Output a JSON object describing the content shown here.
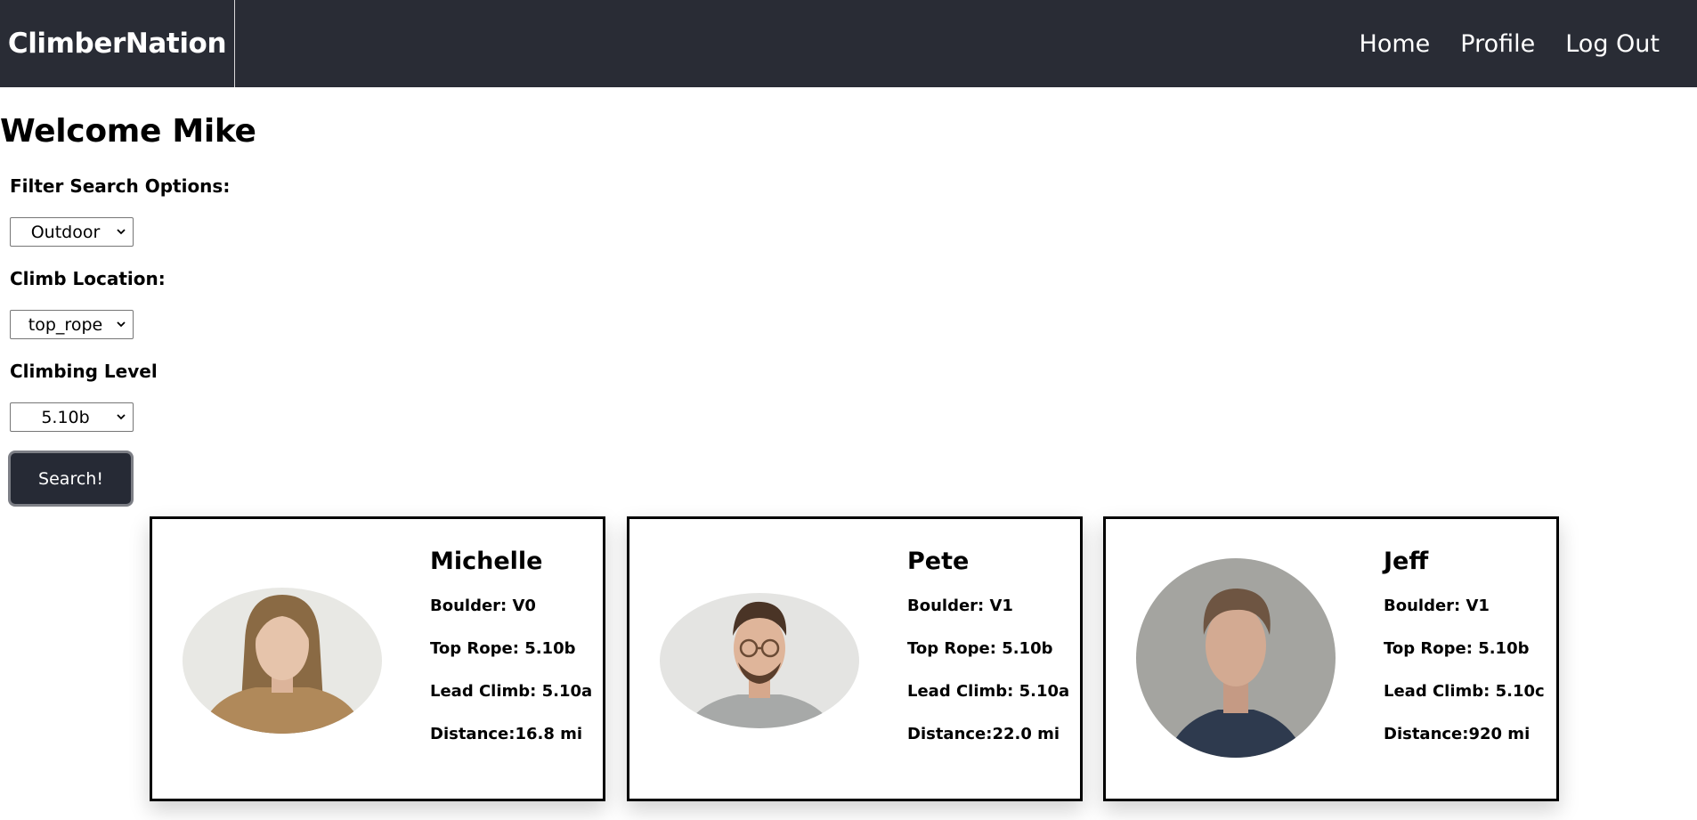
{
  "app": {
    "brand": "ClimberNation"
  },
  "nav": {
    "items": [
      "Home",
      "Profile",
      "Log Out"
    ]
  },
  "welcome": "Welcome Mike",
  "filters": {
    "filter_label": "Filter Search Options:",
    "filter_value": "Outdoor",
    "location_label": "Climb Location:",
    "location_value": "top_rope",
    "level_label": "Climbing Level",
    "level_value": "5.10b"
  },
  "search_button": "Search!",
  "colors": {
    "navbar": "#292c35",
    "button": "#262a35"
  },
  "climbers": [
    {
      "name": "Michelle",
      "boulder": "Boulder: V0",
      "top_rope": "Top Rope: 5.10b",
      "lead": "Lead Climb: 5.10a",
      "distance": "Distance:16.8 mi"
    },
    {
      "name": "Pete",
      "boulder": "Boulder: V1",
      "top_rope": "Top Rope: 5.10b",
      "lead": "Lead Climb: 5.10a",
      "distance": "Distance:22.0 mi"
    },
    {
      "name": "Jeff",
      "boulder": "Boulder: V1",
      "top_rope": "Top Rope: 5.10b",
      "lead": "Lead Climb: 5.10c",
      "distance": "Distance:920 mi"
    }
  ]
}
